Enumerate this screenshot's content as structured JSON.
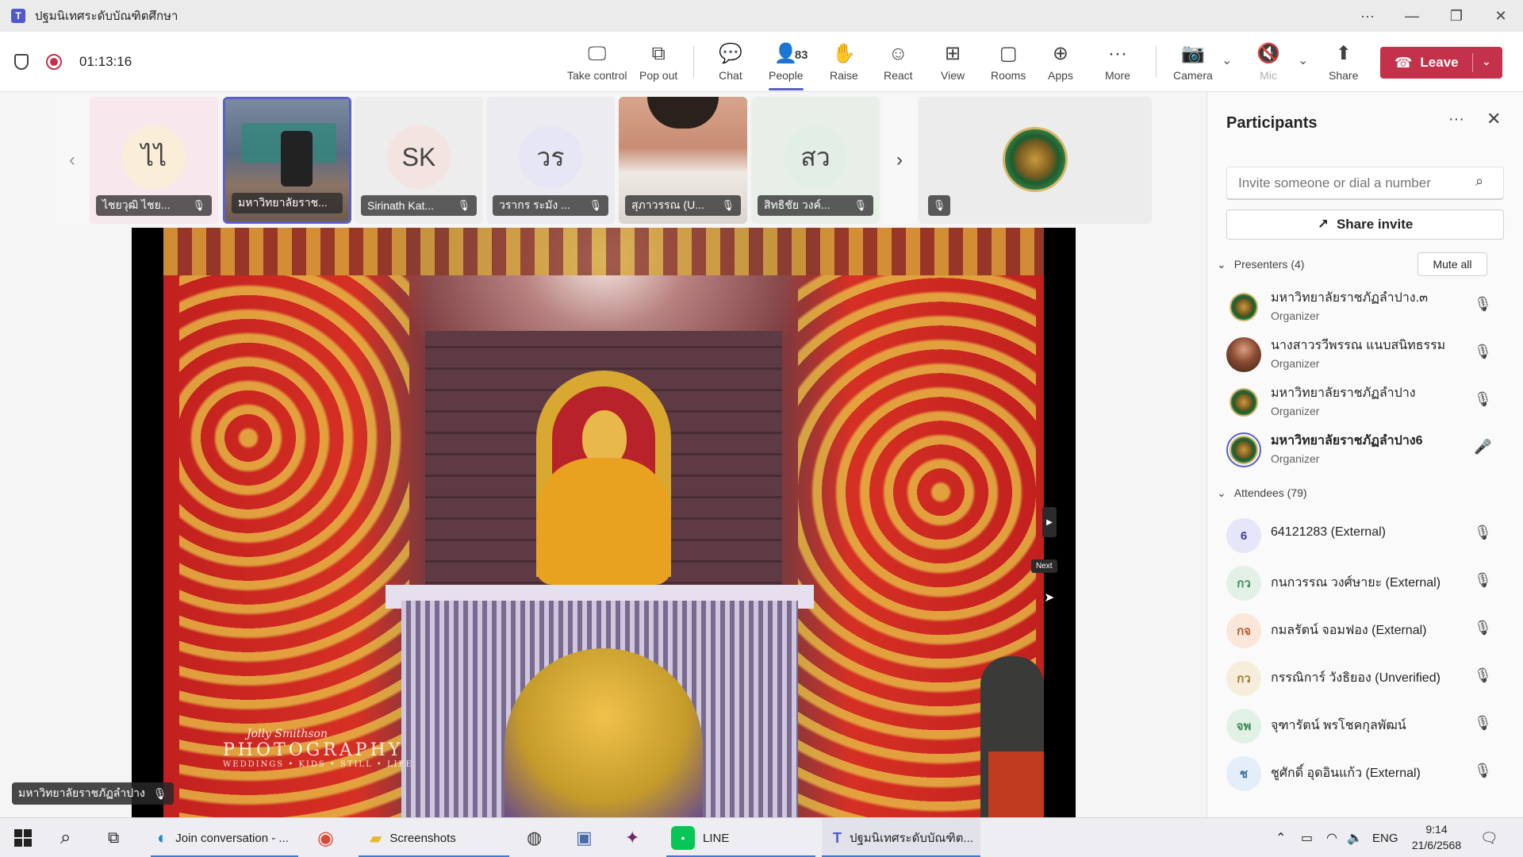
{
  "window": {
    "title": "ปฐมนิเทศระดับบัณฑิตศึกษา",
    "controls": [
      "···",
      "—",
      "❐",
      "✕"
    ]
  },
  "toolbar": {
    "timer": "01:13:16",
    "take_control": "Take control",
    "pop_out": "Pop out",
    "chat": "Chat",
    "people": "People",
    "people_count": "83",
    "raise": "Raise",
    "react": "React",
    "view": "View",
    "rooms": "Rooms",
    "apps": "Apps",
    "more": "More",
    "camera": "Camera",
    "mic": "Mic",
    "share": "Share",
    "leave": "Leave"
  },
  "tiles": [
    {
      "initials": "ไไ",
      "name": "ไชยวุฒิ ไชย...",
      "avatar_color": "#fbeed9"
    },
    {
      "initials": "",
      "name": "มหาวิทยาลัยราช...",
      "avatar_color": ""
    },
    {
      "initials": "SK",
      "name": "Sirinath Kat...",
      "avatar_color": "#f3e4e1"
    },
    {
      "initials": "วร",
      "name": "วรากร ระมัง ...",
      "avatar_color": "#e7e6f5"
    },
    {
      "initials": "",
      "name": "สุภาวรรณ (U...",
      "avatar_color": ""
    },
    {
      "initials": "สว",
      "name": "สิทธิชัย วงค์...",
      "avatar_color": "#e3efe6"
    }
  ],
  "slide": {
    "watermark_script": "Jolly Smithson",
    "watermark_main": "PHOTOGRAPHY",
    "watermark_sub": "WEDDINGS • KIDS • STILL • LIFE",
    "next_tooltip": "Next"
  },
  "speaker": {
    "name": "มหาวิทยาลัยราชภัฏลำปาง"
  },
  "panel": {
    "title": "Participants",
    "invite_placeholder": "Invite someone or dial a number",
    "share_invite": "Share invite",
    "presenters_label": "Presenters (4)",
    "mute_all": "Mute all",
    "attendees_label": "Attendees (79)",
    "presenters": [
      {
        "name": "มหาวิทยาลัยราชภัฏลำปาง.๓",
        "role": "Organizer",
        "avatar": "seal"
      },
      {
        "name": "นางสาวรวีพรรณ แนบสนิทธรรม",
        "role": "Organizer",
        "avatar": "photo"
      },
      {
        "name": "มหาวิทยาลัยราชภัฏลำปาง",
        "role": "Organizer",
        "avatar": "seal"
      },
      {
        "name": "มหาวิทยาลัยราชภัฏลำปาง6",
        "role": "Organizer",
        "avatar": "seal-ring"
      }
    ],
    "attendees": [
      {
        "initials": "6",
        "name": "64121283 (External)",
        "bg": "#e5e6f7",
        "fg": "#3d3f9a"
      },
      {
        "initials": "กว",
        "name": "กนกวรรณ วงศ์ษายะ (External)",
        "bg": "#e2f1e6",
        "fg": "#3e8a56"
      },
      {
        "initials": "กจ",
        "name": "กมลรัตน์ จอมฟอง (External)",
        "bg": "#fbe6da",
        "fg": "#b55a2a"
      },
      {
        "initials": "กว",
        "name": "กรรณิการ์ วังธิยอง (Unverified)",
        "bg": "#f6eddb",
        "fg": "#9a7a3a"
      },
      {
        "initials": "จพ",
        "name": "จุฑารัตน์ พรโชคกุลพัฒน์",
        "bg": "#e2f1e6",
        "fg": "#3e8a56"
      },
      {
        "initials": "ช",
        "name": "ชูศักดิ์ อุดอินแก้ว (External)",
        "bg": "#e3eef8",
        "fg": "#3a6a9a"
      }
    ]
  },
  "taskbar": {
    "edge": "Join conversation - ...",
    "explorer": "Screenshots",
    "line": "LINE",
    "teams": "ปฐมนิเทศระดับบัณฑิต...",
    "lang": "ENG",
    "time": "9:14",
    "date": "21/6/2568"
  }
}
